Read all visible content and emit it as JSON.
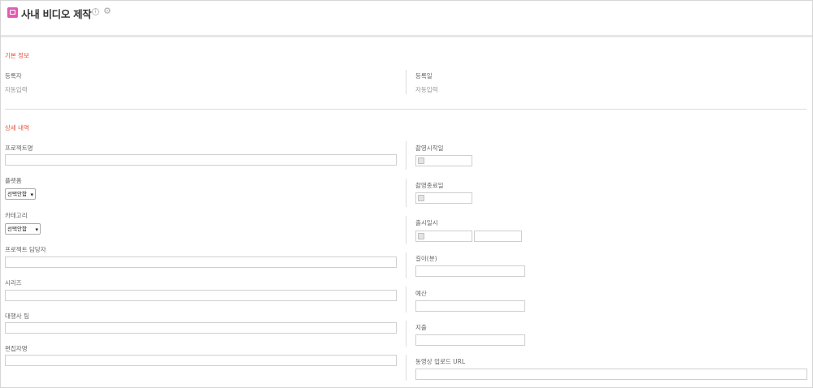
{
  "header": {
    "title": "사내 비디오 제작"
  },
  "sections": {
    "basic": {
      "title": "기본 정보"
    },
    "detail": {
      "title": "상세 내역"
    }
  },
  "basic": {
    "registrant_label": "등록자",
    "registrant_value": "자동입력",
    "reg_date_label": "등록일",
    "reg_date_value": "자동입력"
  },
  "left_fields": {
    "project_name": "프로젝트명",
    "platform": "플랫폼",
    "platform_select": "선택안함",
    "category": "카테고리",
    "category_select": "선택안함",
    "project_manager": "프로젝트 담당자",
    "series": "시리즈",
    "agency_team": "대행사 팀",
    "editor": "편집자명"
  },
  "right_fields": {
    "shoot_start": "촬영시작일",
    "shoot_end": "촬영종료일",
    "release_datetime": "출시일시",
    "length": "길이(분)",
    "budget": "예산",
    "expense": "지출",
    "video_upload_url": "동영상 업로드 URL"
  }
}
